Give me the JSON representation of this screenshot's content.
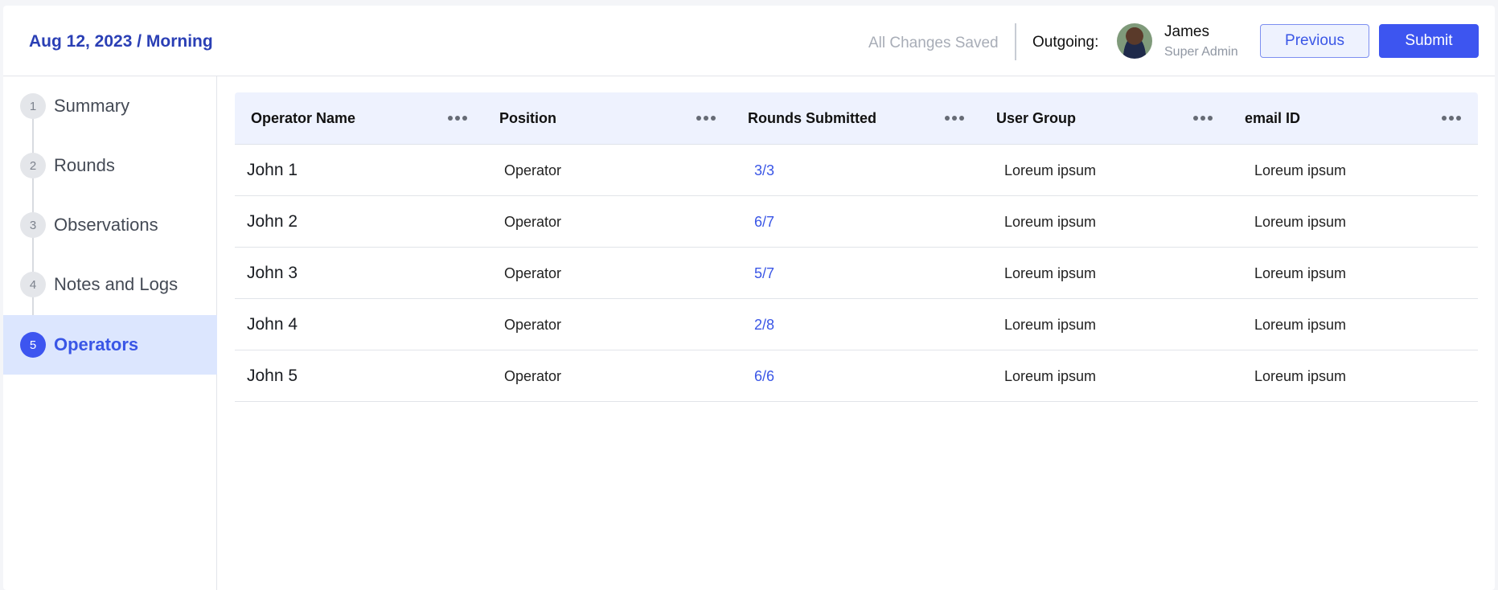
{
  "header": {
    "title": "Aug 12, 2023 / Morning",
    "saved_status": "All Changes Saved",
    "outgoing_label": "Outgoing:",
    "user": {
      "name": "James",
      "role": "Super Admin"
    },
    "previous_label": "Previous",
    "submit_label": "Submit"
  },
  "sidebar": {
    "steps": [
      {
        "number": "1",
        "label": "Summary",
        "active": false
      },
      {
        "number": "2",
        "label": "Rounds",
        "active": false
      },
      {
        "number": "3",
        "label": "Observations",
        "active": false
      },
      {
        "number": "4",
        "label": "Notes and Logs",
        "active": false
      },
      {
        "number": "5",
        "label": "Operators",
        "active": true
      }
    ]
  },
  "table": {
    "columns": [
      "Operator Name",
      "Position",
      "Rounds Submitted",
      "User Group",
      "email ID"
    ],
    "rows": [
      {
        "name": "John 1",
        "position": "Operator",
        "rounds": "3/3",
        "group": "Loreum ipsum",
        "email": "Loreum ipsum"
      },
      {
        "name": "John 2",
        "position": "Operator",
        "rounds": "6/7",
        "group": "Loreum ipsum",
        "email": "Loreum ipsum"
      },
      {
        "name": "John 3",
        "position": "Operator",
        "rounds": "5/7",
        "group": "Loreum ipsum",
        "email": "Loreum ipsum"
      },
      {
        "name": "John 4",
        "position": "Operator",
        "rounds": "2/8",
        "group": "Loreum ipsum",
        "email": "Loreum ipsum"
      },
      {
        "name": "John 5",
        "position": "Operator",
        "rounds": "6/6",
        "group": "Loreum ipsum",
        "email": "Loreum ipsum"
      }
    ]
  },
  "colors": {
    "accent": "#3d55f0",
    "title": "#2a3fb5",
    "active_step_bg": "#dce6fe",
    "header_row_bg": "#eef2fe"
  },
  "icons": {
    "column_menu": "more-horizontal-icon",
    "avatar": "user-avatar"
  }
}
